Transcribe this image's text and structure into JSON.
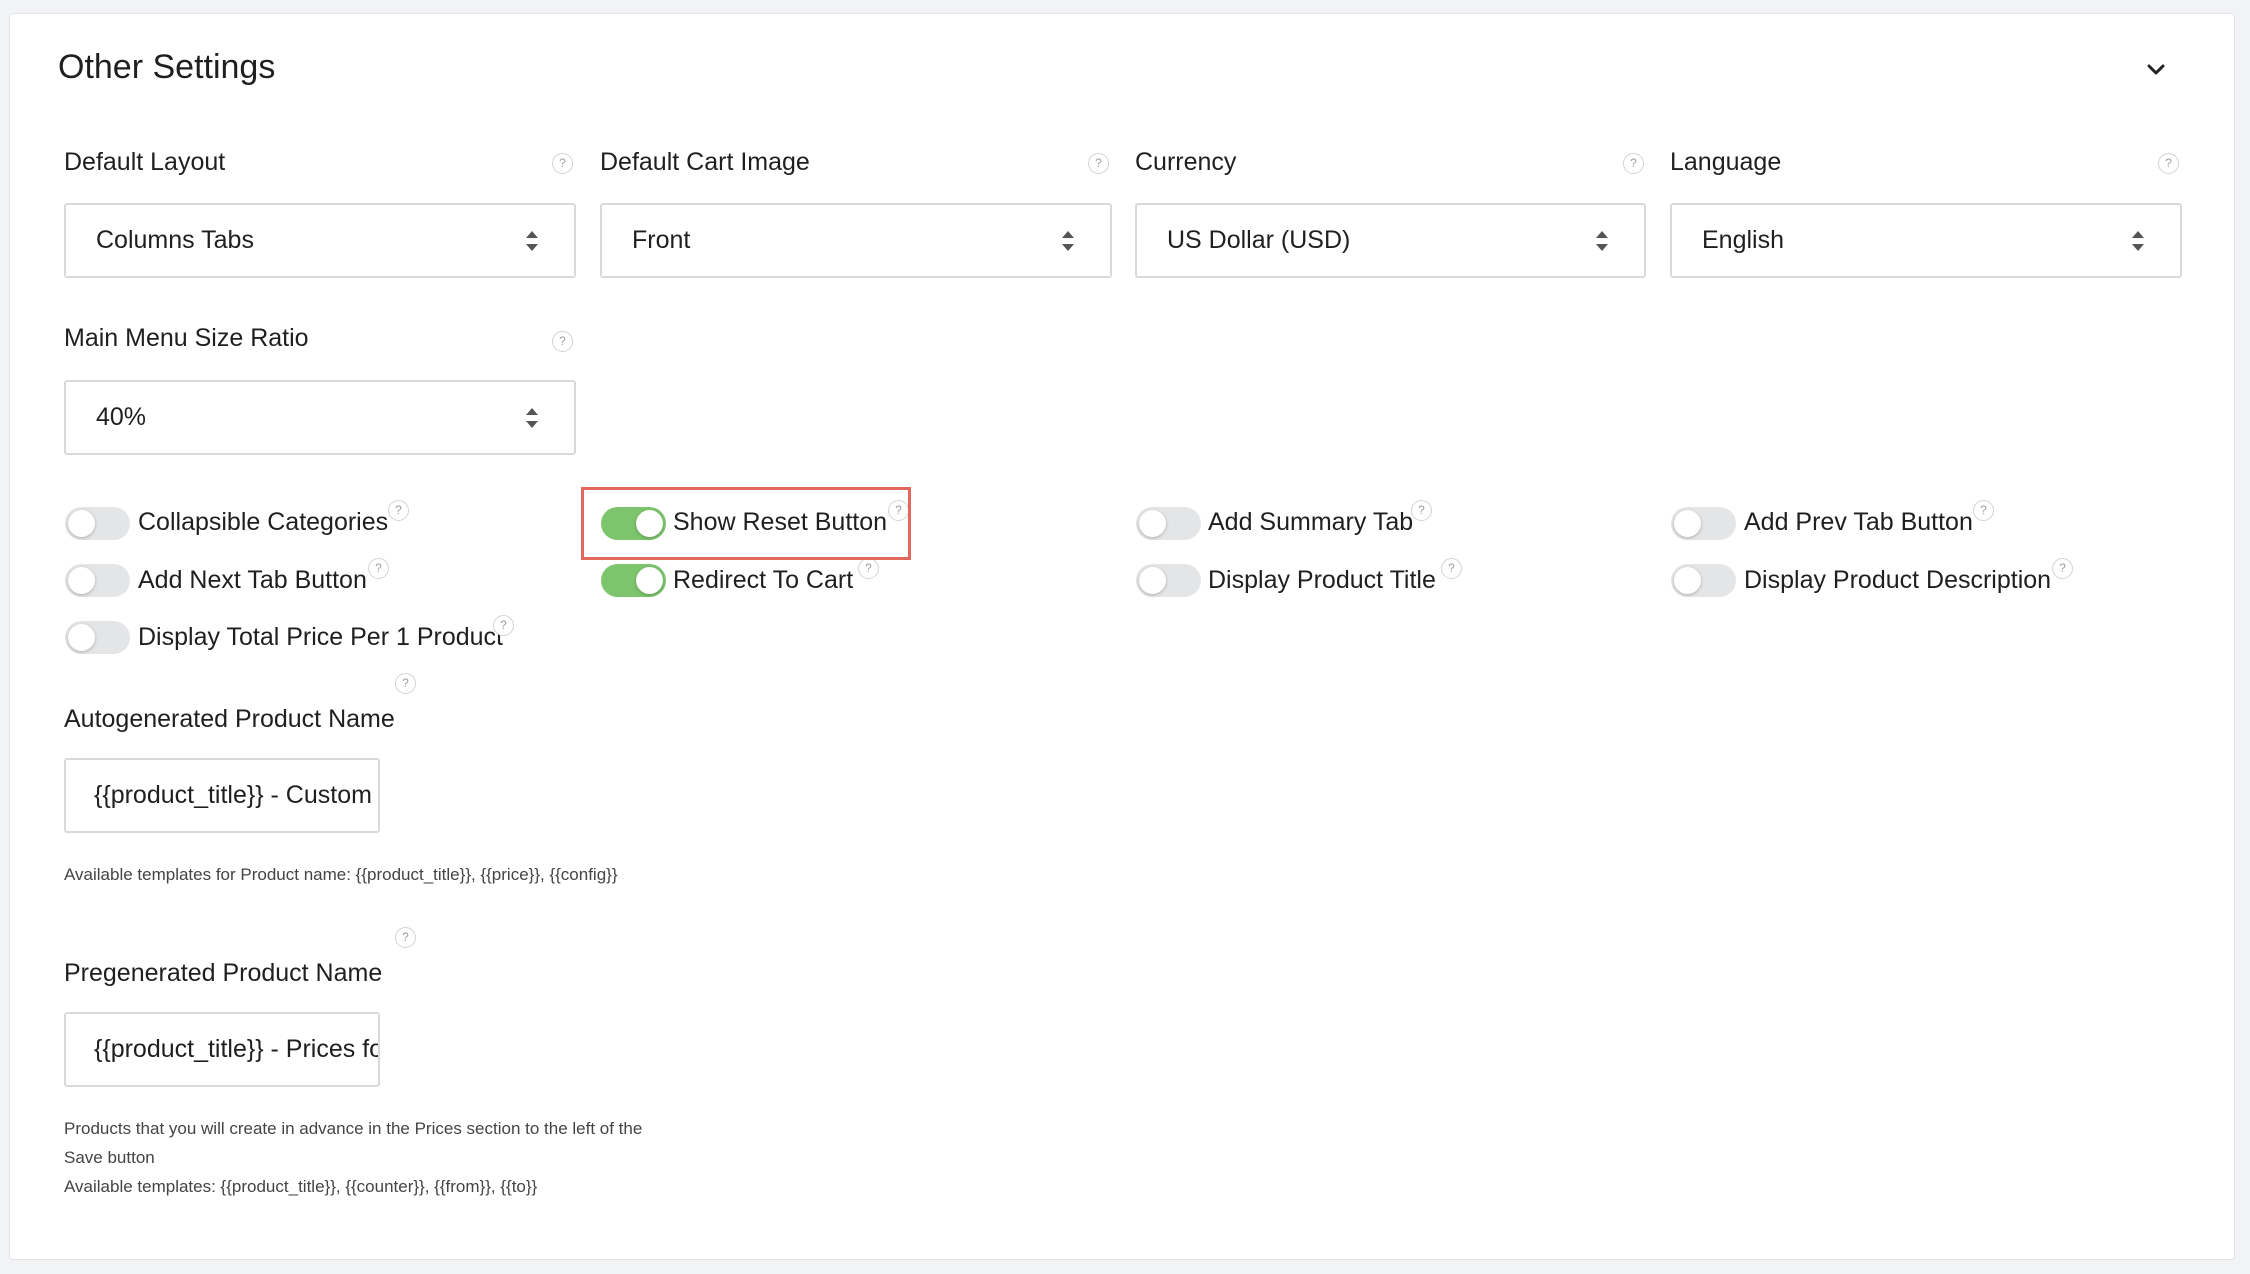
{
  "section": {
    "title": "Other Settings",
    "collapse_icon": "chevron-down-icon"
  },
  "selects": [
    {
      "label": "Default Layout",
      "value": "Columns Tabs"
    },
    {
      "label": "Default Cart Image",
      "value": "Front"
    },
    {
      "label": "Currency",
      "value": "US Dollar (USD)"
    },
    {
      "label": "Language",
      "value": "English"
    },
    {
      "label": "Main Menu Size Ratio",
      "value": "40%"
    }
  ],
  "help_glyph": "?",
  "toggles": [
    {
      "label": "Collapsible Categories",
      "on": false
    },
    {
      "label": "Show Reset Button",
      "on": true
    },
    {
      "label": "Add Summary Tab",
      "on": false
    },
    {
      "label": "Add Prev Tab Button",
      "on": false
    },
    {
      "label": "Add Next Tab Button",
      "on": false
    },
    {
      "label": "Redirect To Cart",
      "on": true
    },
    {
      "label": "Display Product Title",
      "on": false
    },
    {
      "label": "Display Product Description",
      "on": false
    },
    {
      "label": "Display Total Price Per 1 Product",
      "on": false
    }
  ],
  "autogenerated": {
    "label": "Autogenerated Product Name",
    "value": "{{product_title}} - Custom",
    "hint": "Available templates for Product name: {{product_title}}, {{price}}, {{config}}"
  },
  "pregenerated": {
    "label": "Pregenerated Product Name",
    "value": "{{product_title}} - Prices for",
    "hint_line1": "Products that you will create in advance in the Prices section to the left of the",
    "hint_line2": "Save button",
    "hint_line3": "Available templates: {{product_title}}, {{counter}}, {{from}}, {{to}}"
  },
  "colors": {
    "toggle_on": "#7cc56c",
    "toggle_off": "#e4e5e7",
    "highlight": "#e2685e"
  }
}
